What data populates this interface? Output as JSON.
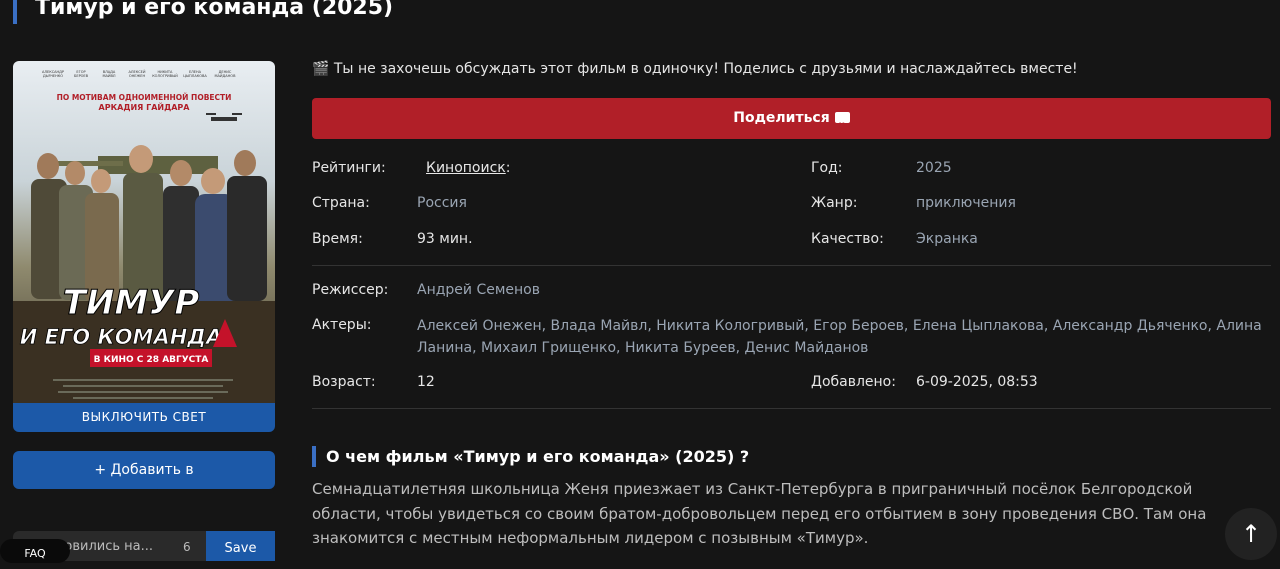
{
  "page": {
    "title": "Тимур и его команда (2025)"
  },
  "sidebar": {
    "lights_label": "ВЫКЛЮЧИТЬ СВЕТ",
    "add_label": "+ Добавить в",
    "collection_placeholder": "Остановились на...",
    "collection_value": "6",
    "save_label": "Save",
    "faq_label": "FAQ"
  },
  "poster": {
    "top_credit": "ПО МОТИВАМ ОДНОИМЕННОЙ ПОВЕСТИ",
    "top_author": "АРКАДИЯ ГАЙДАРА",
    "title_line1": "ТИМУР",
    "title_line2": "И ЕГО КОМАНДА",
    "release": "В КИНО С 28 АВГУСТА"
  },
  "share": {
    "text": "🎬 Ты не захочешь обсуждать этот фильм в одиночку! Поделись с друзьями и наслаждайтесь вместе!",
    "button_label": "Поделиться"
  },
  "info": {
    "ratings_label": "Рейтинги:",
    "ratings_kp": "Кинопоиск",
    "ratings_sep": ":",
    "year_label": "Год:",
    "year": "2025",
    "country_label": "Страна:",
    "country": "Россия",
    "genre_label": "Жанр:",
    "genre": "приключения",
    "time_label": "Время:",
    "time": "93 мин.",
    "quality_label": "Качество:",
    "quality": "Экранка",
    "director_label": "Режиссер:",
    "director": "Андрей Семенов",
    "actors_label": "Актеры:",
    "actors": [
      "Алексей Онежен",
      "Влада Майвл",
      "Никита Кологривый",
      "Егор Бероев",
      "Елена Цыплакова",
      "Александр Дьяченко",
      "Алина Ланина",
      "Михаил Грищенко",
      "Никита Буреев",
      "Денис Майданов"
    ],
    "age_label": "Возраст:",
    "age": "12",
    "added_label": "Добавлено:",
    "added": "6-09-2025, 08:53"
  },
  "about": {
    "heading": "О чем фильм «Тимур и его команда» (2025) ?",
    "text": "Семнадцатилетняя школьница Женя приезжает из Санкт-Петербурга в приграничный посёлок Белгородской области, чтобы увидеться со своим братом-добровольцем перед его отбытием в зону проведения СВО. Там она знакомится с местным неформальным лидером с позывным «Тимур»."
  },
  "scroll_top_icon": "↑",
  "colors": {
    "background": "#151515",
    "accent_blue": "#1c59a8",
    "share_red": "#b11f28",
    "muted_value": "#9aa5b3"
  }
}
